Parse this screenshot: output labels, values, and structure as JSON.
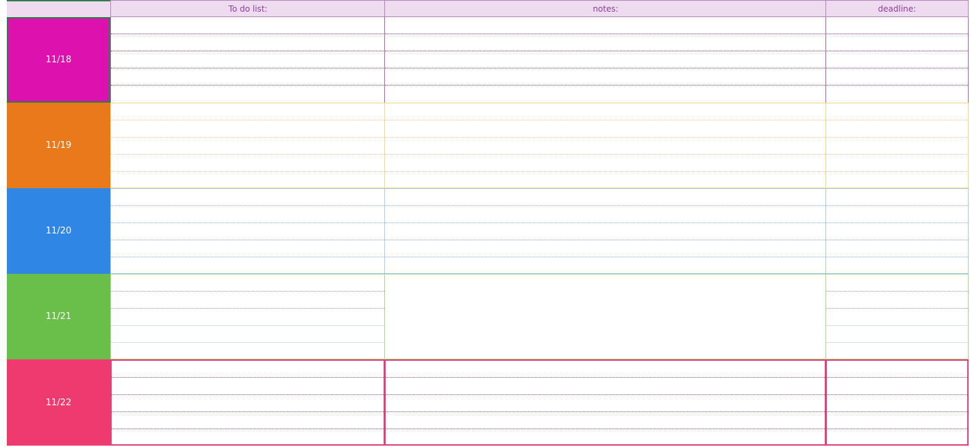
{
  "header": {
    "todo_label": "To do list:",
    "notes_label": "notes:",
    "deadline_label": "deadline:"
  },
  "days": [
    {
      "date": "11/18",
      "color": "#dd12ae",
      "selected": true
    },
    {
      "date": "11/19",
      "color": "#e9791b"
    },
    {
      "date": "11/20",
      "color": "#2f86e4"
    },
    {
      "date": "11/21",
      "color": "#6abf4b"
    },
    {
      "date": "11/22",
      "color": "#ee3b6f"
    }
  ],
  "colors": {
    "header_bg": "#eedbef",
    "header_text": "#8a3d9a",
    "selection_border": "#2e7d46"
  }
}
